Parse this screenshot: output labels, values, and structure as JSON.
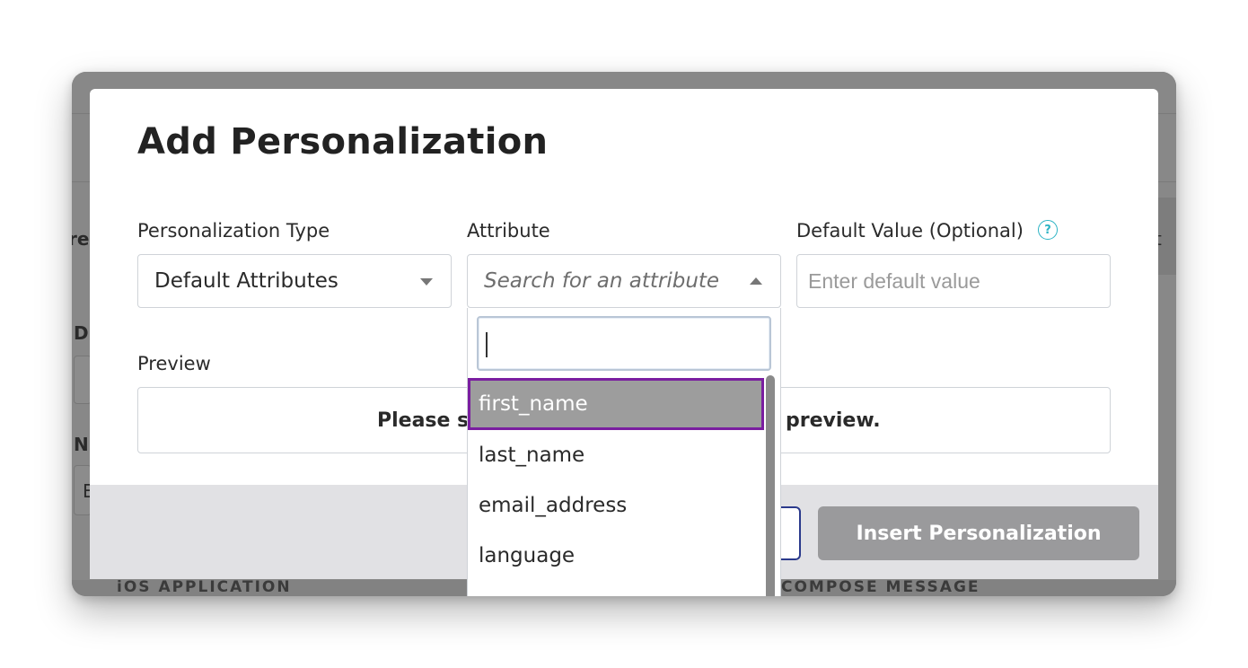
{
  "background": {
    "fragments": [
      "re",
      "D",
      "N",
      "E",
      "t"
    ],
    "bottom_left": "iOS APPLICATION",
    "bottom_right": "COMPOSE MESSAGE"
  },
  "modal": {
    "title": "Add Personalization",
    "personalization_type": {
      "label": "Personalization Type",
      "value": "Default Attributes"
    },
    "attribute": {
      "label": "Attribute",
      "placeholder": "Search for an attribute",
      "search_value": "",
      "options": [
        "first_name",
        "last_name",
        "email_address",
        "language"
      ],
      "highlighted": "first_name"
    },
    "default_value": {
      "label": "Default Value (Optional)",
      "help_icon": "?",
      "placeholder": "Enter default value"
    },
    "preview": {
      "label": "Preview",
      "text_left": "Please se",
      "text_right": "preview."
    },
    "footer": {
      "cancel_label": "",
      "insert_label": "Insert Personalization"
    }
  },
  "colors": {
    "highlight_border": "#7a1ea0",
    "insert_button_bg": "#9a9a9c",
    "cancel_border": "#2b3a8c",
    "help_icon": "#2bb3c4"
  }
}
